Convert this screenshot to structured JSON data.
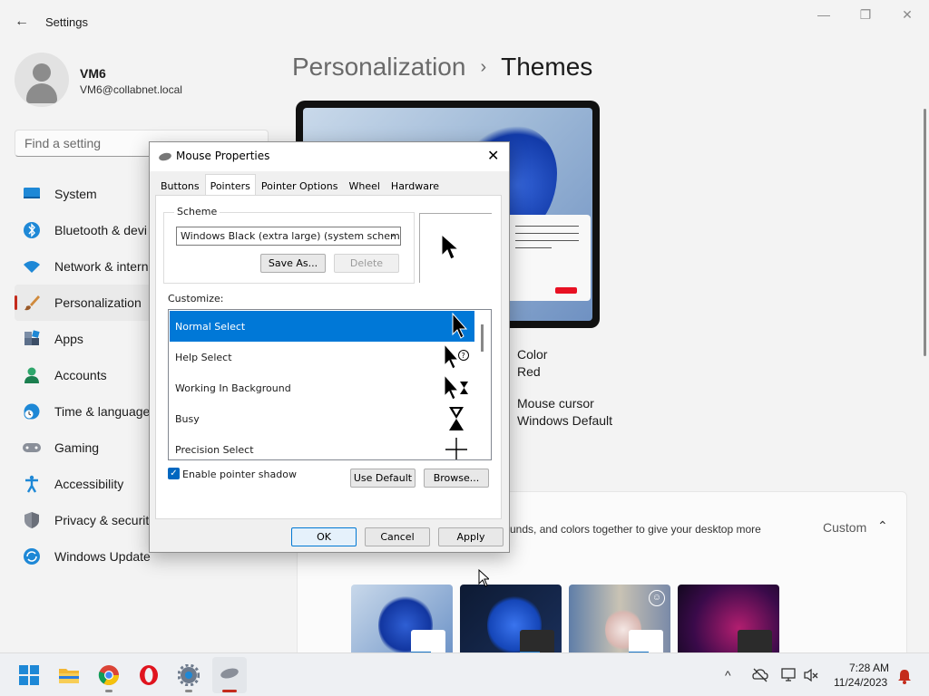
{
  "window": {
    "title": "Settings",
    "controls": {
      "minimize": "—",
      "maximize": "❐",
      "close": "✕"
    }
  },
  "user": {
    "name": "VM6",
    "email": "VM6@collabnet.local"
  },
  "search": {
    "placeholder": "Find a setting"
  },
  "sidebar": {
    "items": [
      {
        "label": "System",
        "icon": "system-icon"
      },
      {
        "label": "Bluetooth & devi",
        "icon": "bluetooth-icon"
      },
      {
        "label": "Network & intern",
        "icon": "network-icon"
      },
      {
        "label": "Personalization",
        "icon": "personalization-icon",
        "active": true
      },
      {
        "label": "Apps",
        "icon": "apps-icon"
      },
      {
        "label": "Accounts",
        "icon": "accounts-icon"
      },
      {
        "label": "Time & language",
        "icon": "time-language-icon"
      },
      {
        "label": "Gaming",
        "icon": "gaming-icon"
      },
      {
        "label": "Accessibility",
        "icon": "accessibility-icon"
      },
      {
        "label": "Privacy & security",
        "icon": "privacy-icon"
      },
      {
        "label": "Windows Update",
        "icon": "windows-update-icon"
      }
    ]
  },
  "breadcrumb": {
    "parent": "Personalization",
    "separator": "›",
    "current": "Themes"
  },
  "theme_info": {
    "color_label": "Color",
    "color_value": "Red",
    "cursor_label": "Mouse cursor",
    "cursor_value": "Windows Default"
  },
  "themes_section": {
    "description": "unds, and colors together to give your desktop more",
    "toggle_label": "Custom",
    "chevron": "⌃"
  },
  "dialog": {
    "title": "Mouse Properties",
    "close": "✕",
    "tabs": [
      "Buttons",
      "Pointers",
      "Pointer Options",
      "Wheel",
      "Hardware"
    ],
    "active_tab": "Pointers",
    "scheme_label": "Scheme",
    "scheme_value": "Windows Black (extra large) (system scheme)",
    "save_as": "Save As...",
    "delete": "Delete",
    "customize_label": "Customize:",
    "pointers": [
      {
        "name": "Normal Select",
        "icon": "arrow-cursor-icon",
        "selected": true
      },
      {
        "name": "Help Select",
        "icon": "help-cursor-icon"
      },
      {
        "name": "Working In Background",
        "icon": "working-cursor-icon"
      },
      {
        "name": "Busy",
        "icon": "busy-cursor-icon"
      },
      {
        "name": "Precision Select",
        "icon": "crosshair-cursor-icon"
      }
    ],
    "enable_shadow": "Enable pointer shadow",
    "use_default": "Use Default",
    "browse": "Browse...",
    "ok": "OK",
    "cancel": "Cancel",
    "apply": "Apply"
  },
  "taskbar": {
    "time": "7:28 AM",
    "date": "11/24/2023",
    "tray_chevron": "^"
  },
  "colors": {
    "accent": "#c42b1c",
    "selection": "#0078d7",
    "checkbox": "#0067c0"
  }
}
